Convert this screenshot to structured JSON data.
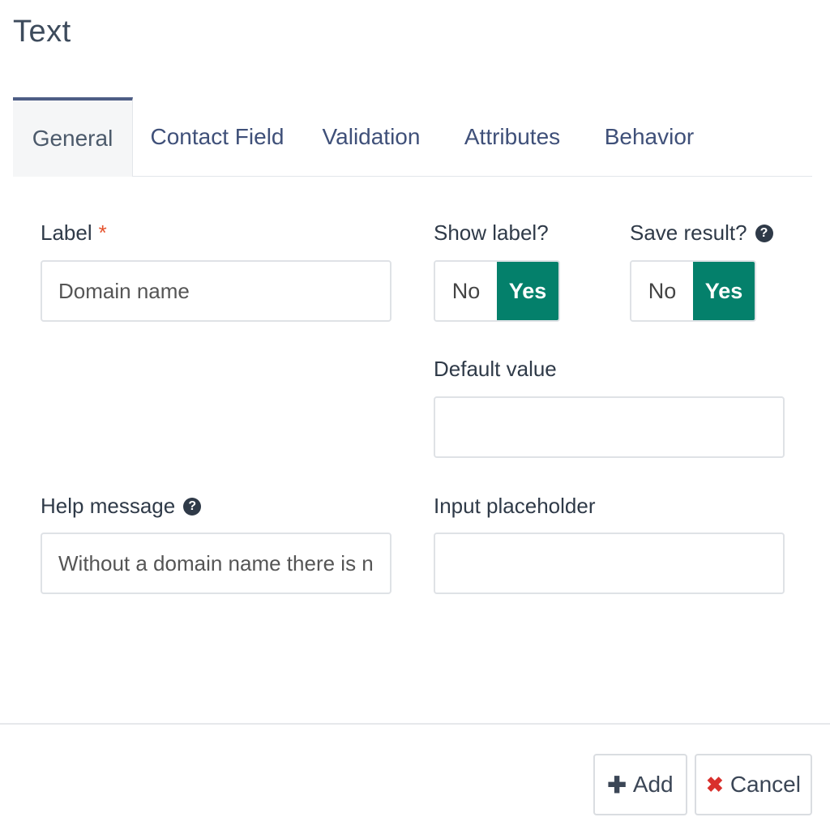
{
  "modal": {
    "title": "Text"
  },
  "tabs": [
    {
      "label": "General",
      "active": true
    },
    {
      "label": "Contact Field",
      "active": false
    },
    {
      "label": "Validation",
      "active": false
    },
    {
      "label": "Attributes",
      "active": false
    },
    {
      "label": "Behavior",
      "active": false
    }
  ],
  "form": {
    "label": {
      "label": "Label",
      "required_marker": "*",
      "value": "Domain name"
    },
    "show_label": {
      "label": "Show label?",
      "no": "No",
      "yes": "Yes",
      "selected": "Yes"
    },
    "save_result": {
      "label": "Save result?",
      "help_icon": "question-circle-icon",
      "no": "No",
      "yes": "Yes",
      "selected": "Yes"
    },
    "default_value": {
      "label": "Default value",
      "value": ""
    },
    "help_message": {
      "label": "Help message",
      "help_icon": "question-circle-icon",
      "value": "Without a domain name there is no w"
    },
    "input_placeholder": {
      "label": "Input placeholder",
      "value": ""
    }
  },
  "footer": {
    "add_label": "Add",
    "add_icon": "plus-icon",
    "cancel_label": "Cancel",
    "cancel_icon": "x-icon"
  },
  "colors": {
    "accent_green": "#04806b",
    "tab_border": "#4e5d85",
    "required": "#e5522c",
    "cancel_x": "#d9302c"
  }
}
